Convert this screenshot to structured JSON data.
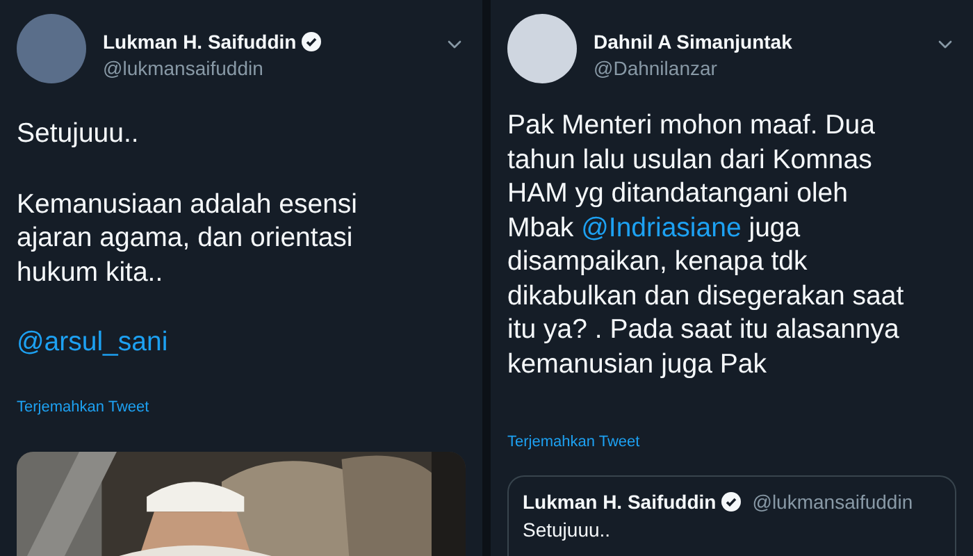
{
  "tweets": [
    {
      "author": {
        "name": "Lukman H. Saifuddin",
        "verified": true,
        "handle": "@lukmansaifuddin"
      },
      "paragraphs": [
        [
          {
            "kind": "text",
            "text": "Setujuuu.."
          }
        ],
        [
          {
            "kind": "text",
            "text": "Kemanusiaan adalah esensi\najaran agama, dan orientasi\nhukum kita.."
          }
        ],
        [
          {
            "kind": "mention",
            "text": "@arsul_sani"
          }
        ]
      ],
      "translate": "Terjemahkan Tweet",
      "media": {
        "kind": "picture"
      }
    },
    {
      "author": {
        "name": "Dahnil A Simanjuntak",
        "verified": false,
        "handle": "@Dahnilanzar"
      },
      "paragraphs": [
        [
          {
            "kind": "text",
            "text": "Pak Menteri mohon maaf. Dua\ntahun lalu usulan dari Komnas\nHAM yg ditandatangani oleh\nMbak "
          },
          {
            "kind": "mention",
            "text": "@Indriasiane"
          },
          {
            "kind": "text",
            "text": " juga\ndisampaikan, kenapa tdk\ndikabulkan dan disegerakan saat\nitu ya? . Pada saat itu alasannya\nkemanusian juga Pak"
          }
        ]
      ],
      "translate": "Terjemahkan Tweet",
      "quote": {
        "name": "Lukman H. Saifuddin",
        "verified": true,
        "handle": "@lukmansaifuddin",
        "text": "Setujuuu.."
      }
    }
  ]
}
